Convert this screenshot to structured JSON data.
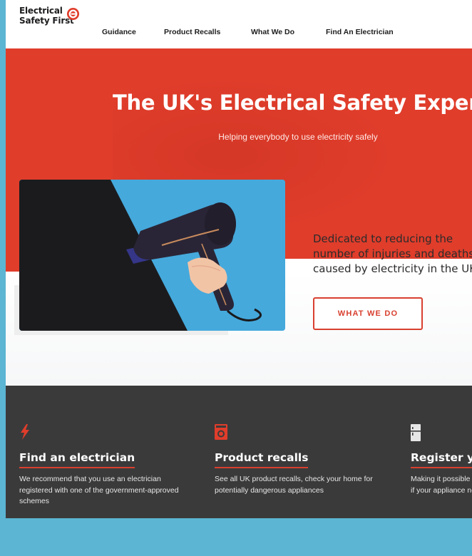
{
  "brand": {
    "line1": "Electrical",
    "line2": "Safety First",
    "accent": "#e03d2b"
  },
  "nav": {
    "items": [
      "Guidance",
      "Product Recalls",
      "What We Do",
      "Find An Electrician"
    ]
  },
  "hero": {
    "title": "The UK's Electrical Safety Experts",
    "subtitle": "Helping everybody to use electricity safely",
    "image": "hair-dryer-photo"
  },
  "intro": {
    "text": "Dedicated to reducing the number of injuries and deaths caused by electricity in the UK",
    "button_label": "WHAT WE DO"
  },
  "features": [
    {
      "icon": "lightning-icon",
      "title": "Find an electrician",
      "text": "We recommend that you use an electrician registered with one of the government-approved schemes"
    },
    {
      "icon": "washing-machine-icon",
      "title": "Product recalls",
      "text": "See all UK product recalls, check your home for potentially dangerous appliances"
    },
    {
      "icon": "fridge-icon",
      "title": "Register your appliances",
      "text": "Making it possible for manufacturers to contact you if your appliance needs attention"
    }
  ],
  "colors": {
    "hero_red": "#e03d2b",
    "dark_section": "#3b3a3b",
    "outer_background": "#5bb5d3"
  }
}
